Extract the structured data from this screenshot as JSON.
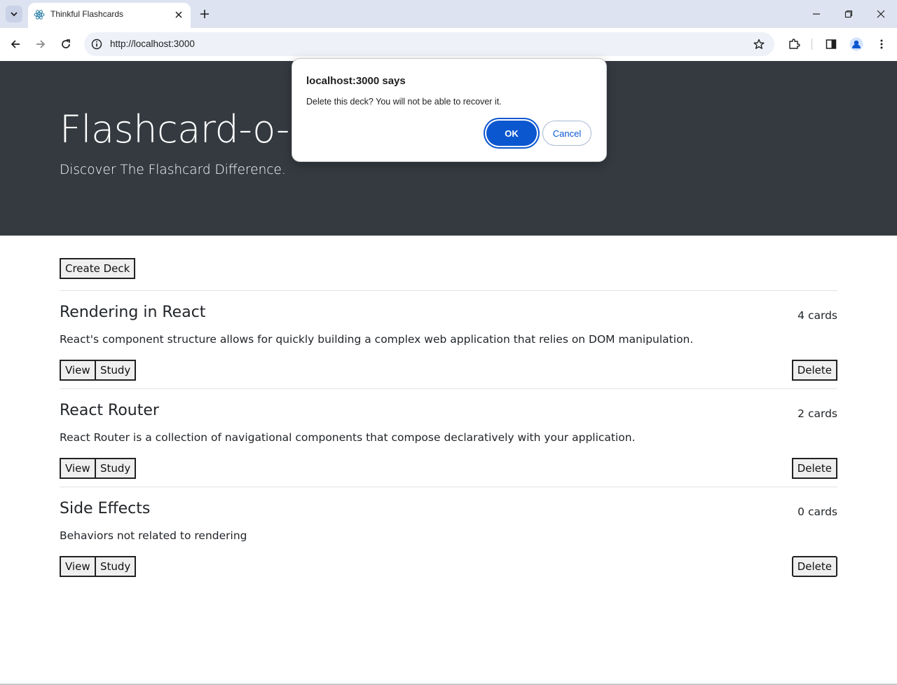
{
  "browser": {
    "tab_title": "Thinkful Flashcards",
    "url": "http://localhost:3000",
    "accent_color": "#0b57d0",
    "tabstrip_color": "#dde3f0"
  },
  "hero": {
    "title": "Flashcard-o-matic",
    "subtitle": "Discover The Flashcard Difference.",
    "background": "#343a40"
  },
  "main": {
    "create_label": "Create Deck",
    "decks": [
      {
        "name": "Rendering in React",
        "count": "4 cards",
        "description": "React's component structure allows for quickly building a complex web application that relies on DOM manipulation.",
        "view_label": "View",
        "study_label": "Study",
        "delete_label": "Delete"
      },
      {
        "name": "React Router",
        "count": "2 cards",
        "description": "React Router is a collection of navigational components that compose declaratively with your application.",
        "view_label": "View",
        "study_label": "Study",
        "delete_label": "Delete"
      },
      {
        "name": "Side Effects",
        "count": "0 cards",
        "description": "Behaviors not related to rendering",
        "view_label": "View",
        "study_label": "Study",
        "delete_label": "Delete"
      }
    ]
  },
  "dialog": {
    "title": "localhost:3000 says",
    "message": "Delete this deck? You will not be able to recover it.",
    "ok_label": "OK",
    "cancel_label": "Cancel"
  },
  "icons": {
    "tab_search": "chevron-down-icon",
    "favicon": "react-icon",
    "tab_close": "close-icon",
    "new_tab": "plus-icon",
    "minimize": "minimize-icon",
    "restore": "restore-icon",
    "close_window": "close-icon",
    "back": "back-arrow-icon",
    "forward": "forward-arrow-icon",
    "reload": "reload-icon",
    "site_info": "info-icon",
    "bookmark": "star-icon",
    "extensions": "puzzle-icon",
    "side_panel": "side-panel-icon",
    "profile": "profile-icon",
    "menu": "kebab-menu-icon"
  }
}
